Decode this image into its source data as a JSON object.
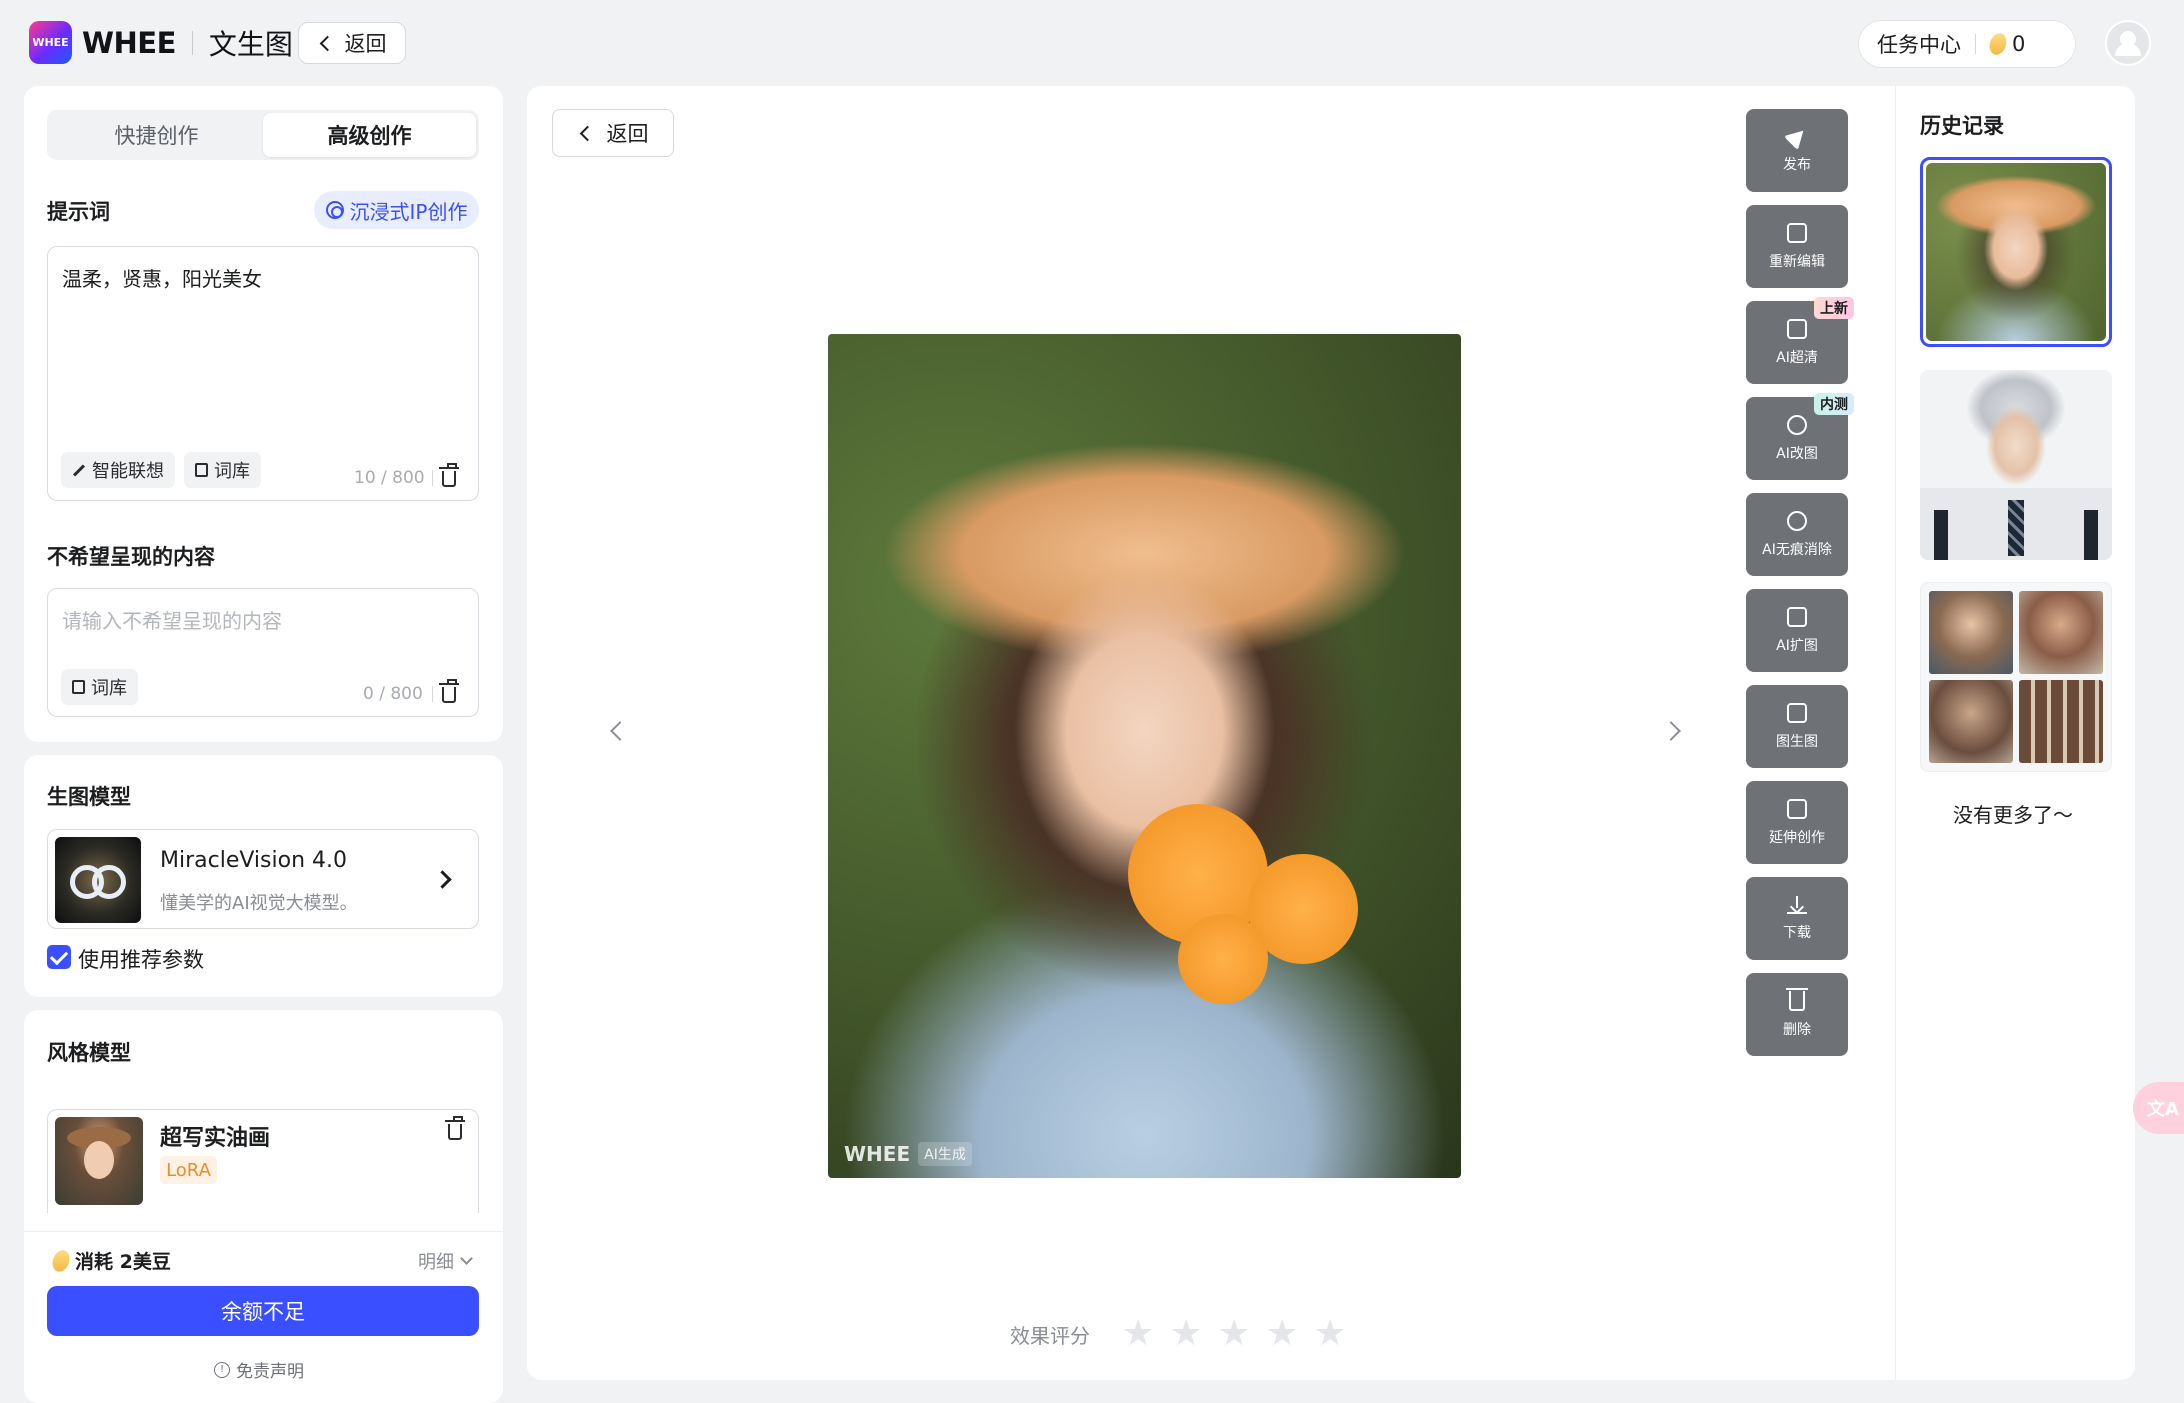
{
  "brand": {
    "logo_text": "WHEE",
    "logo_mark": "WHEE"
  },
  "header": {
    "page_title": "文生图",
    "back_label": "返回",
    "task_center": "任务中心",
    "bean_count": "0"
  },
  "left_panel": {
    "tabs": [
      {
        "label": "快捷创作"
      },
      {
        "label": "高级创作"
      }
    ],
    "prompt": {
      "title": "提示词",
      "ip_button": "沉浸式IP创作",
      "value": "温柔，贤惠，阳光美女",
      "smart_assoc": "智能联想",
      "library": "词库",
      "counter": "10 / 800"
    },
    "negative": {
      "title": "不希望呈现的内容",
      "placeholder": "请输入不希望呈现的内容",
      "library": "词库",
      "counter": "0 / 800"
    },
    "model": {
      "title": "生图模型",
      "name": "MiracleVision 4.0",
      "desc": "懂美学的AI视觉大模型。",
      "use_recommended": "使用推荐参数"
    },
    "style": {
      "title": "风格模型",
      "name": "超写实油画",
      "tag": "LoRA"
    },
    "footer": {
      "cost": "消耗 2美豆",
      "detail": "明细",
      "primary_button": "余额不足",
      "disclaimer": "免责声明"
    }
  },
  "main": {
    "back_label": "返回",
    "watermark_brand": "WHEE",
    "watermark_tag": "AI生成",
    "rating_label": "效果评分",
    "rating_value": 0,
    "rating_max": 5,
    "tools": [
      {
        "label": "发布",
        "icon": "send-icon"
      },
      {
        "label": "重新编辑",
        "icon": "image-edit-icon"
      },
      {
        "label": "AI超清",
        "icon": "hd-icon",
        "badge": "上新"
      },
      {
        "label": "AI改图",
        "icon": "brush-icon",
        "badge": "内测"
      },
      {
        "label": "AI无痕消除",
        "icon": "eraser-icon"
      },
      {
        "label": "AI扩图",
        "icon": "expand-icon"
      },
      {
        "label": "图生图",
        "icon": "image-to-image-icon"
      },
      {
        "label": "延伸创作",
        "icon": "extend-icon"
      },
      {
        "label": "下载",
        "icon": "download-icon"
      },
      {
        "label": "删除",
        "icon": "trash-icon"
      }
    ]
  },
  "history": {
    "title": "历史记录",
    "no_more": "没有更多了～"
  },
  "colors": {
    "accent": "#3a4fff",
    "tool_bg": "#6e7176",
    "lora": "#f08a24"
  }
}
